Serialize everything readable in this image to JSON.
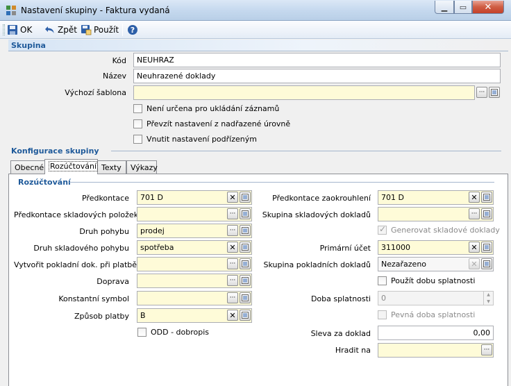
{
  "window": {
    "title": "Nastavení skupiny - Faktura vydaná",
    "min_glyph": "▁",
    "max_glyph": "▭",
    "close_glyph": "✕"
  },
  "toolbar": {
    "ok_label": "OK",
    "back_label": "Zpět",
    "use_label": "Použít"
  },
  "skupina": {
    "section_title": "Skupina",
    "kod_label": "Kód",
    "kod_value": "NEUHRAZ",
    "nazev_label": "Název",
    "nazev_value": "Neuhrazené doklady",
    "sablona_label": "Výchozí šablona",
    "sablona_value": "",
    "checkboxes": [
      {
        "label": "Není určena pro ukládání záznamů",
        "checked": false
      },
      {
        "label": "Převzít nastavení z nadřazené úrovně",
        "checked": false
      },
      {
        "label": "Vnutit nastavení podřízeným",
        "checked": false
      }
    ]
  },
  "konfigurace": {
    "section_title": "Konfigurace skupiny",
    "tabs": [
      {
        "label": "Obecné",
        "active": false
      },
      {
        "label": "Rozúčtování",
        "active": true
      },
      {
        "label": "Texty",
        "active": false
      },
      {
        "label": "Výkazy",
        "active": false
      }
    ]
  },
  "rozuctovani": {
    "section_title": "Rozúčtování",
    "left": [
      {
        "label": "Předkontace",
        "value": "701 D"
      },
      {
        "label": "Předkontace skladových položek",
        "value": ""
      },
      {
        "label": "Druh pohybu",
        "value": "prodej"
      },
      {
        "label": "Druh skladového pohybu",
        "value": "spotřeba"
      },
      {
        "label": "Vytvořit pokladní dok. při platbě",
        "value": ""
      },
      {
        "label": "Doprava",
        "value": ""
      },
      {
        "label": "Konstantní symbol",
        "value": ""
      },
      {
        "label": "Způsob platby",
        "value": "B"
      }
    ],
    "odd_label": "ODD - dobropis",
    "right": {
      "predkontace_zaokr_label": "Předkontace zaokrouhlení",
      "predkontace_zaokr_value": "701 D",
      "skupina_sklad_label": "Skupina skladových dokladů",
      "skupina_sklad_value": "",
      "generovat_label": "Generovat skladové doklady",
      "primarni_ucet_label": "Primární účet",
      "primarni_ucet_value": "311000",
      "skupina_pokl_label": "Skupina pokladních dokladů",
      "skupina_pokl_value": "Nezařazeno",
      "pouzit_dobu_label": "Použít dobu splatnosti",
      "doba_label": "Doba splatnosti",
      "doba_value": "0",
      "pevna_doba_label": "Pevná doba splatnosti",
      "sleva_label": "Sleva za doklad",
      "sleva_value": "0,00",
      "hradit_label": "Hradit na",
      "hradit_value": ""
    }
  },
  "icons": {
    "ellipsis_glyph": "···",
    "clear_glyph": "✕",
    "spin_up": "▲",
    "spin_down": "▼"
  }
}
